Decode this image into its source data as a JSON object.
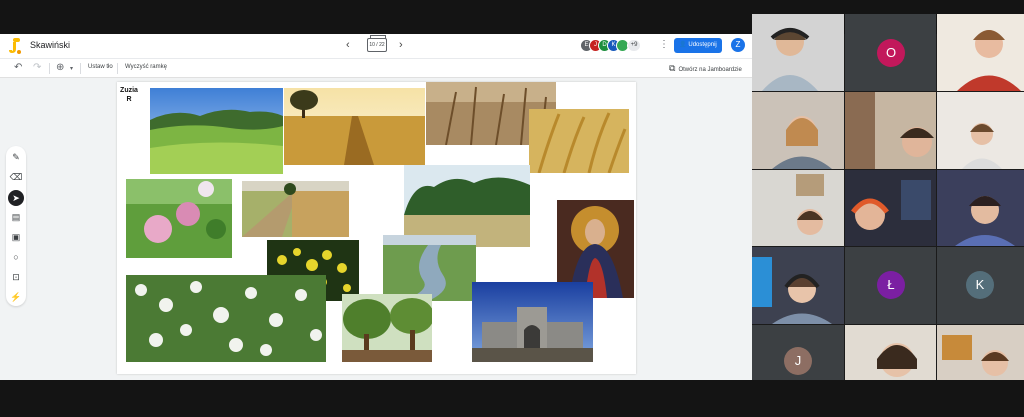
{
  "jamboard": {
    "title": "Skawiński",
    "frame_indicator": "10 / 22",
    "collaborators": [
      {
        "initial": "E",
        "color": "#5f6368"
      },
      {
        "initial": "J",
        "color": "#c5221f"
      },
      {
        "initial": "D",
        "color": "#1e8e3e"
      },
      {
        "initial": "K",
        "color": "#185abc"
      },
      {
        "initial": "",
        "color": "#34a853"
      }
    ],
    "more_collaborators": "+9",
    "share_label": "Udostępnij",
    "user_initial": "Z",
    "toolbar": {
      "set_background": "Ustaw tło",
      "clear_frame": "Wyczyść ramkę",
      "open_on_jamboard": "Otwórz na Jamboardzie"
    },
    "note_text": "Zuzia R"
  },
  "meeting": {
    "tiles": [
      {
        "label": "participant",
        "initial": ""
      },
      {
        "label": "participant",
        "initial": "O",
        "color": "#c2185b"
      },
      {
        "label": "participant",
        "initial": ""
      },
      {
        "label": "participant",
        "initial": ""
      },
      {
        "label": "participant",
        "initial": ""
      },
      {
        "label": "participant",
        "initial": ""
      },
      {
        "label": "participant",
        "initial": ""
      },
      {
        "label": "participant",
        "initial": ""
      },
      {
        "label": "participant",
        "initial": ""
      },
      {
        "label": "participant",
        "initial": ""
      },
      {
        "label": "participant",
        "initial": "Ł",
        "color": "#7b1fa2"
      },
      {
        "label": "participant",
        "initial": "K",
        "color": "#546e7a"
      },
      {
        "label": "participant",
        "initial": "J",
        "color": "#8d6e63"
      },
      {
        "label": "participant",
        "initial": ""
      },
      {
        "label": "participant",
        "initial": ""
      }
    ]
  },
  "colors": {
    "accent": "#1a73e8",
    "dark_bg": "#1b1b1b"
  }
}
